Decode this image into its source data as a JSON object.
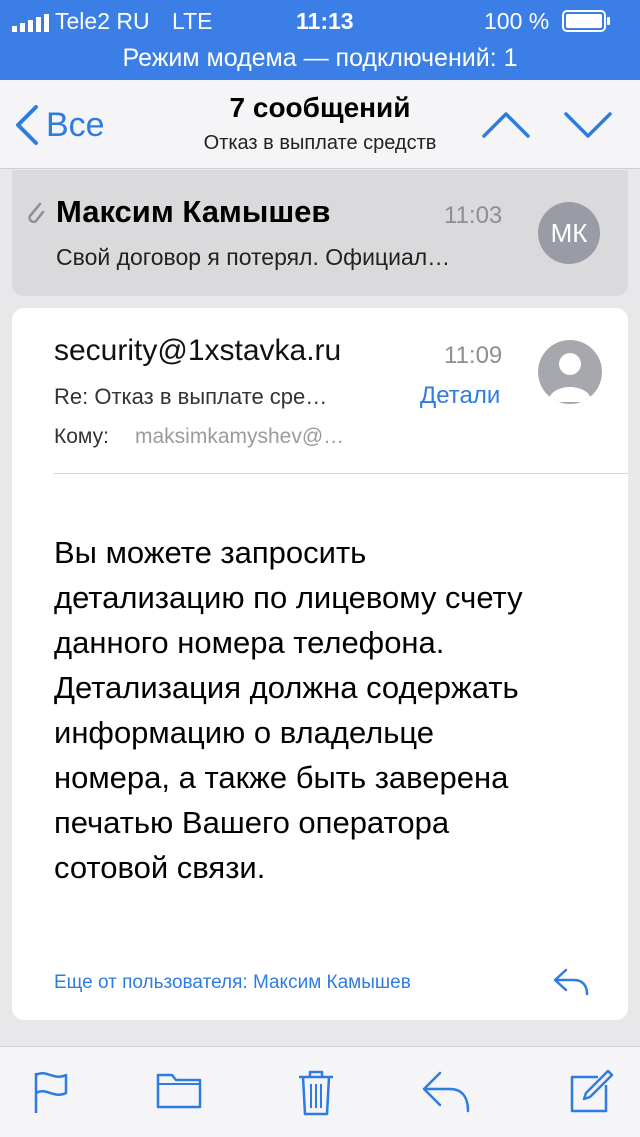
{
  "status_bar": {
    "carrier": "Tele2 RU",
    "network": "LTE",
    "time": "11:13",
    "battery": "100 %",
    "tethering": "Режим модема — подключений: 1"
  },
  "nav": {
    "back_label": "Все",
    "title": "7 сообщений",
    "subtitle": "Отказ в выплате средств"
  },
  "collapsed_message": {
    "sender": "Максим Камышев",
    "time": "11:03",
    "preview": "Свой договор я потерял. Официал…",
    "avatar_initials": "МК"
  },
  "expanded_message": {
    "sender": "security@1xstavka.ru",
    "time": "11:09",
    "subject": "Re: Отказ в выплате сре…",
    "details_label": "Детали",
    "to_label": "Кому:",
    "to_value": "maksimkamyshev@…",
    "body": "Вы можете запросить\nдетализацию по лицевому счету\nданного номера телефона.\nДетализация должна содержать\nинформацию о владельце\nномера, а также быть заверена\nпечатью Вашего оператора\nсотовой связи.",
    "more_from": "Еще от пользователя: Максим Камышев"
  },
  "toolbar": {
    "icons": [
      "flag-icon",
      "folder-icon",
      "trash-icon",
      "reply-icon",
      "compose-icon"
    ]
  },
  "colors": {
    "accent": "#2f7ce0",
    "status_bar_bg": "#3a7ee6"
  }
}
